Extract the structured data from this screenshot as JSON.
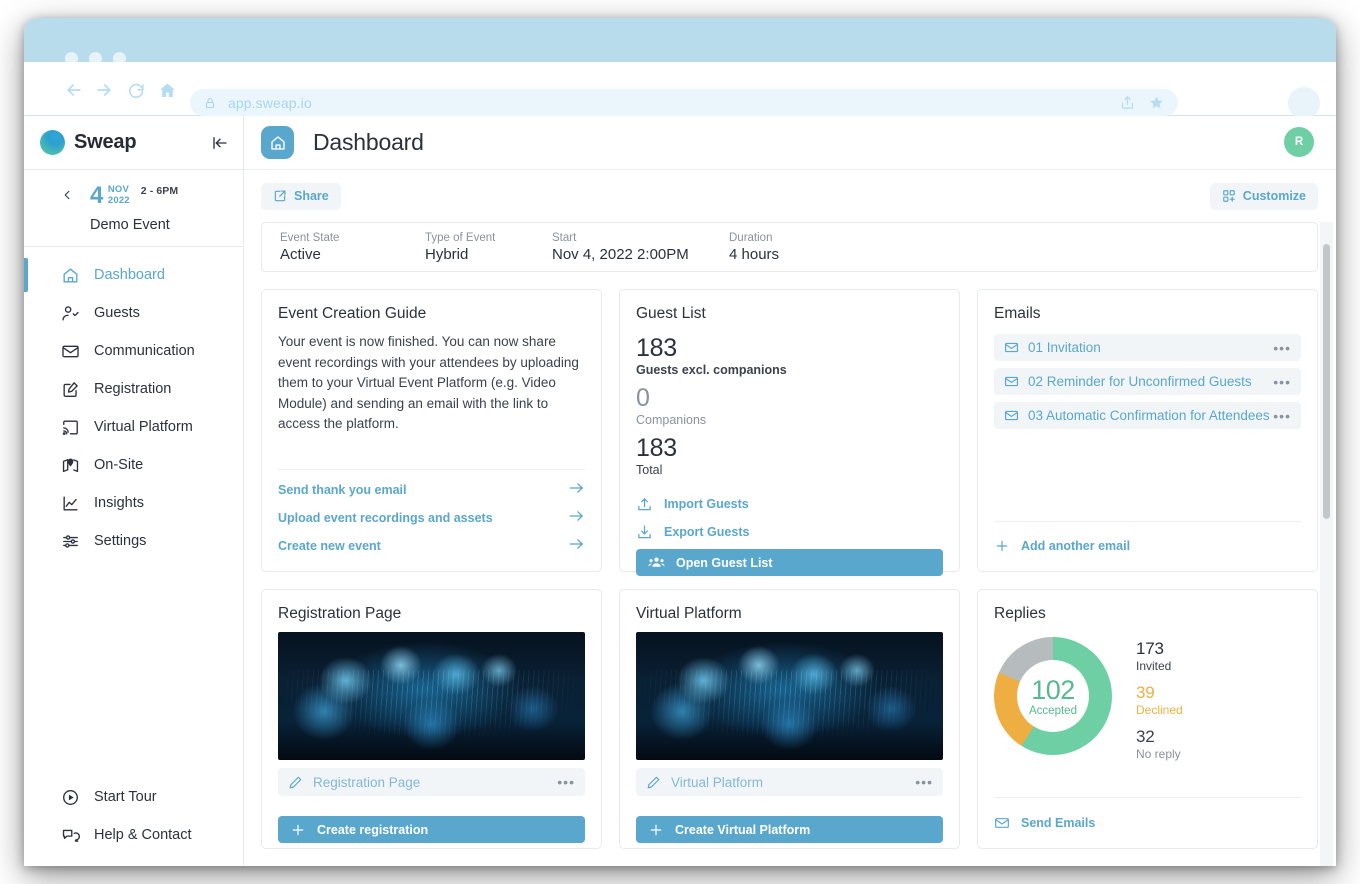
{
  "browser": {
    "url": "app.sweap.io",
    "lock_icon": "lock-icon",
    "back_icon": "arrow-left-icon",
    "forward_icon": "arrow-right-icon",
    "reload_icon": "reload-icon",
    "home_icon": "home-icon",
    "share_icon": "share-icon",
    "bookmark_icon": "star-icon"
  },
  "sidebar": {
    "brand": "Sweap",
    "collapse_icon": "collapse-sidebar-icon",
    "event": {
      "back_icon": "chevron-left-icon",
      "day": "4",
      "month": "NOV",
      "year": "2022",
      "time": "2 - 6PM",
      "name": "Demo Event"
    },
    "items": [
      {
        "label": "Dashboard",
        "icon": "home-icon",
        "active": true
      },
      {
        "label": "Guests",
        "icon": "person-check-icon",
        "active": false
      },
      {
        "label": "Communication",
        "icon": "envelope-icon",
        "active": false
      },
      {
        "label": "Registration",
        "icon": "edit-square-icon",
        "active": false
      },
      {
        "label": "Virtual Platform",
        "icon": "screen-cast-icon",
        "active": false
      },
      {
        "label": "On-Site",
        "icon": "map-pin-icon",
        "active": false
      },
      {
        "label": "Insights",
        "icon": "line-chart-icon",
        "active": false
      },
      {
        "label": "Settings",
        "icon": "sliders-icon",
        "active": false
      }
    ],
    "bottom_items": [
      {
        "label": "Start Tour",
        "icon": "play-circle-icon"
      },
      {
        "label": "Help & Contact",
        "icon": "chat-bubbles-icon"
      }
    ]
  },
  "header": {
    "title": "Dashboard",
    "page_icon": "home-icon",
    "avatar_initial": "R"
  },
  "toolbar": {
    "share_label": "Share",
    "share_icon": "external-link-icon",
    "customize_label": "Customize",
    "customize_icon": "widgets-add-icon"
  },
  "event_summary": [
    {
      "label": "Event State",
      "value": "Active"
    },
    {
      "label": "Type of Event",
      "value": "Hybrid"
    },
    {
      "label": "Start",
      "value": "Nov 4, 2022 2:00PM"
    },
    {
      "label": "Duration",
      "value": "4 hours"
    }
  ],
  "cards": {
    "guide": {
      "title": "Event Creation Guide",
      "body": "Your event is now finished. You can now share event recordings with your attendees by uploading them to your Virtual Event Platform (e.g. Video Module) and sending an email with the link to access the platform.",
      "links": [
        {
          "label": "Send thank you email",
          "icon": "arrow-right-icon"
        },
        {
          "label": "Upload event recordings and assets",
          "icon": "arrow-right-icon"
        },
        {
          "label": "Create new event",
          "icon": "arrow-right-icon"
        }
      ]
    },
    "guest_list": {
      "title": "Guest List",
      "stats": [
        {
          "value": "183",
          "caption": "Guests excl. companions",
          "style": "bold"
        },
        {
          "value": "0",
          "caption": "Companions",
          "style": "muted"
        },
        {
          "value": "183",
          "caption": "Total",
          "style": "normal"
        }
      ],
      "actions": [
        {
          "label": "Import Guests",
          "icon": "upload-icon"
        },
        {
          "label": "Export Guests",
          "icon": "download-icon"
        }
      ],
      "primary": {
        "label": "Open Guest List",
        "icon": "group-people-icon"
      }
    },
    "emails": {
      "title": "Emails",
      "rows": [
        {
          "label": "01 Invitation",
          "icon": "envelope-icon",
          "menu_icon": "more-horizontal-icon"
        },
        {
          "label": "02 Reminder for Unconfirmed Guests",
          "icon": "envelope-icon",
          "menu_icon": "more-horizontal-icon"
        },
        {
          "label": "03 Automatic Confirmation for Attendees",
          "icon": "envelope-icon",
          "menu_icon": "more-horizontal-icon"
        }
      ],
      "add": {
        "label": "Add another email",
        "icon": "plus-icon"
      }
    },
    "registration_page": {
      "title": "Registration Page",
      "item_label": "Registration Page",
      "item_icon": "pencil-icon",
      "menu_icon": "more-horizontal-icon",
      "primary": {
        "label": "Create registration",
        "icon": "plus-icon"
      }
    },
    "virtual_platform": {
      "title": "Virtual Platform",
      "item_label": "Virtual Platform",
      "item_icon": "pencil-icon",
      "menu_icon": "more-horizontal-icon",
      "primary": {
        "label": "Create Virtual Platform",
        "icon": "plus-icon"
      }
    },
    "replies": {
      "title": "Replies",
      "center_value": "102",
      "center_caption": "Accepted",
      "legend": [
        {
          "value": "173",
          "caption": "Invited",
          "color": "#2b313d",
          "caption_color": "#3b424e"
        },
        {
          "value": "39",
          "caption": "Declined",
          "color": "#efae42",
          "caption_color": "#efae42"
        },
        {
          "value": "32",
          "caption": "No reply",
          "color": "#3b424e",
          "caption_color": "#8a929d"
        }
      ],
      "send_emails": {
        "label": "Send Emails",
        "icon": "envelope-icon"
      }
    }
  },
  "chart_data": {
    "type": "pie",
    "title": "Replies",
    "subtype": "donut",
    "categories": [
      "Accepted",
      "Declined",
      "No reply"
    ],
    "values": [
      102,
      39,
      32
    ],
    "colors": [
      "#6ecfa5",
      "#efae42",
      "#b6bbbd"
    ],
    "total_invited": 173,
    "center_label": "102",
    "center_sublabel": "Accepted",
    "percentages": [
      59.0,
      22.5,
      18.5
    ],
    "legend_position": "right",
    "grid": false
  },
  "colors": {
    "accent_blue": "#5aa7cd",
    "title_bar": "#b9dced",
    "green": "#6ecfa5",
    "orange": "#efae42",
    "gray": "#b6bbbd",
    "text": "#2b313d",
    "muted": "#8a929d"
  }
}
